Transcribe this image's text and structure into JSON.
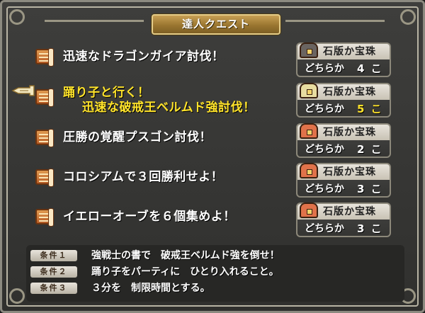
{
  "window": {
    "title": "達人クエスト"
  },
  "quests": [
    {
      "name_line1": "迅速なドラゴンガイア討伐！",
      "name_line2": "",
      "reward_type": "石版か宝珠",
      "reward_either": "どちらか",
      "reward_count": "4 こ",
      "selected": false,
      "chest_color": "#6a6460"
    },
    {
      "name_line1": "踊り子と行く！",
      "name_line2": "迅速な破戒王ベルムド強討伐！",
      "reward_type": "石版か宝珠",
      "reward_either": "どちらか",
      "reward_count": "5 こ",
      "selected": true,
      "chest_color": "#e8dca0"
    },
    {
      "name_line1": "圧勝の覚醒プスゴン討伐！",
      "name_line2": "",
      "reward_type": "石版か宝珠",
      "reward_either": "どちらか",
      "reward_count": "2 こ",
      "selected": false,
      "chest_color": "#e0724a"
    },
    {
      "name_line1": "コロシアムで３回勝利せよ！",
      "name_line2": "",
      "reward_type": "石版か宝珠",
      "reward_either": "どちらか",
      "reward_count": "3 こ",
      "selected": false,
      "chest_color": "#e0724a"
    },
    {
      "name_line1": "イエローオーブを６個集めよ！",
      "name_line2": "",
      "reward_type": "石版か宝珠",
      "reward_either": "どちらか",
      "reward_count": "3 こ",
      "selected": false,
      "chest_color": "#e0724a"
    }
  ],
  "conditions": [
    {
      "label": "条件１",
      "text": "強戦士の書で　破戒王ベルムド強を倒せ！"
    },
    {
      "label": "条件２",
      "text": "踊り子をパーティに　ひとり入れること。"
    },
    {
      "label": "条件３",
      "text": "３分を　制限時間とする。"
    }
  ],
  "colors": {
    "highlight": "#ffe32a",
    "text": "#ffffff",
    "frame": "#8c8a80",
    "title_plate": "#b08a3e"
  },
  "icons": {
    "cursor": "pointing-hand-icon",
    "quest": "scroll-icon",
    "reward": "treasure-chest-icon"
  }
}
